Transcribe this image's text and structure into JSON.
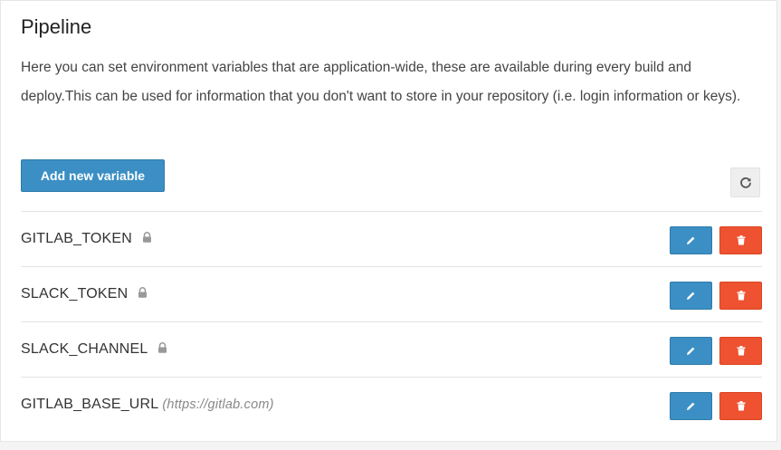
{
  "section": {
    "title": "Pipeline",
    "description": "Here you can set environment variables that are application-wide, these are available during every build and deploy.This can be used for information that you don't want to store in your repository (i.e. login information or keys)."
  },
  "toolbar": {
    "add_label": "Add new variable",
    "refresh_icon": "refresh-icon"
  },
  "variables": [
    {
      "name": "GITLAB_TOKEN",
      "protected": true,
      "value": ""
    },
    {
      "name": "SLACK_TOKEN",
      "protected": true,
      "value": ""
    },
    {
      "name": "SLACK_CHANNEL",
      "protected": true,
      "value": ""
    },
    {
      "name": "GITLAB_BASE_URL",
      "protected": false,
      "value": "(https://gitlab.com)"
    }
  ],
  "colors": {
    "primary": "#3b8fc4",
    "danger": "#ee5230"
  }
}
